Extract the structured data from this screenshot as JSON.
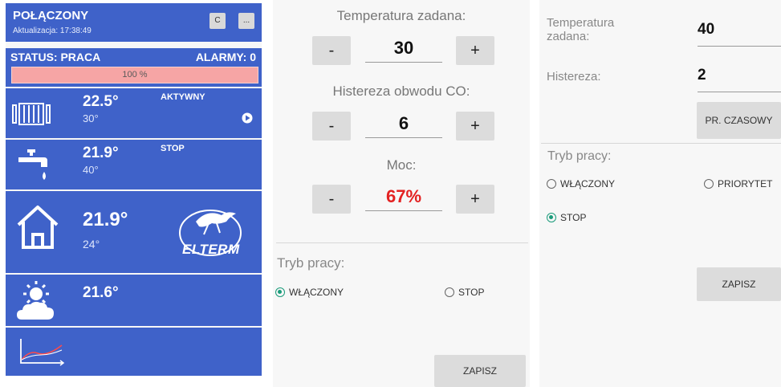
{
  "left": {
    "header": {
      "title": "POŁĄCZONY",
      "update": "Aktualizacja: 17:38:49",
      "btn_c": "C",
      "btn_more": "..."
    },
    "status": {
      "label": "STATUS: PRACA",
      "alarms": "ALARMY: 0",
      "progress_label": "100 %",
      "progress_value": 100
    },
    "radiator": {
      "temp": "22.5°",
      "set": "30°",
      "state": "AKTYWNY"
    },
    "tap": {
      "temp": "21.9°",
      "set": "40°",
      "state": "STOP"
    },
    "home": {
      "temp": "21.9°",
      "set": "24°",
      "logo": "ELTERM"
    },
    "weather": {
      "temp": "21.6°"
    }
  },
  "middle": {
    "temp_title": "Temperatura zadana:",
    "temp_value": "30",
    "hyst_title": "Histereza obwodu CO:",
    "hyst_value": "6",
    "power_title": "Moc:",
    "power_value": "67%",
    "minus": "-",
    "plus": "+",
    "mode_title": "Tryb pracy:",
    "opt_on": "WŁĄCZONY",
    "opt_stop": "STOP",
    "save": "ZAPISZ"
  },
  "right": {
    "temp_label": "Temperatura zadana:",
    "temp_value": "40",
    "hyst_label": "Histereza:",
    "hyst_value": "2",
    "schedule": "PR. CZASOWY",
    "mode_title": "Tryb pracy:",
    "opt_on": "WŁĄCZONY",
    "opt_priority": "PRIORYTET",
    "opt_stop": "STOP",
    "save": "ZAPISZ"
  },
  "colors": {
    "tile_blue": "#3f62c9",
    "progress_red": "#f6a5a5",
    "power_red": "#e32222",
    "radio_green": "#1a9b7a"
  }
}
